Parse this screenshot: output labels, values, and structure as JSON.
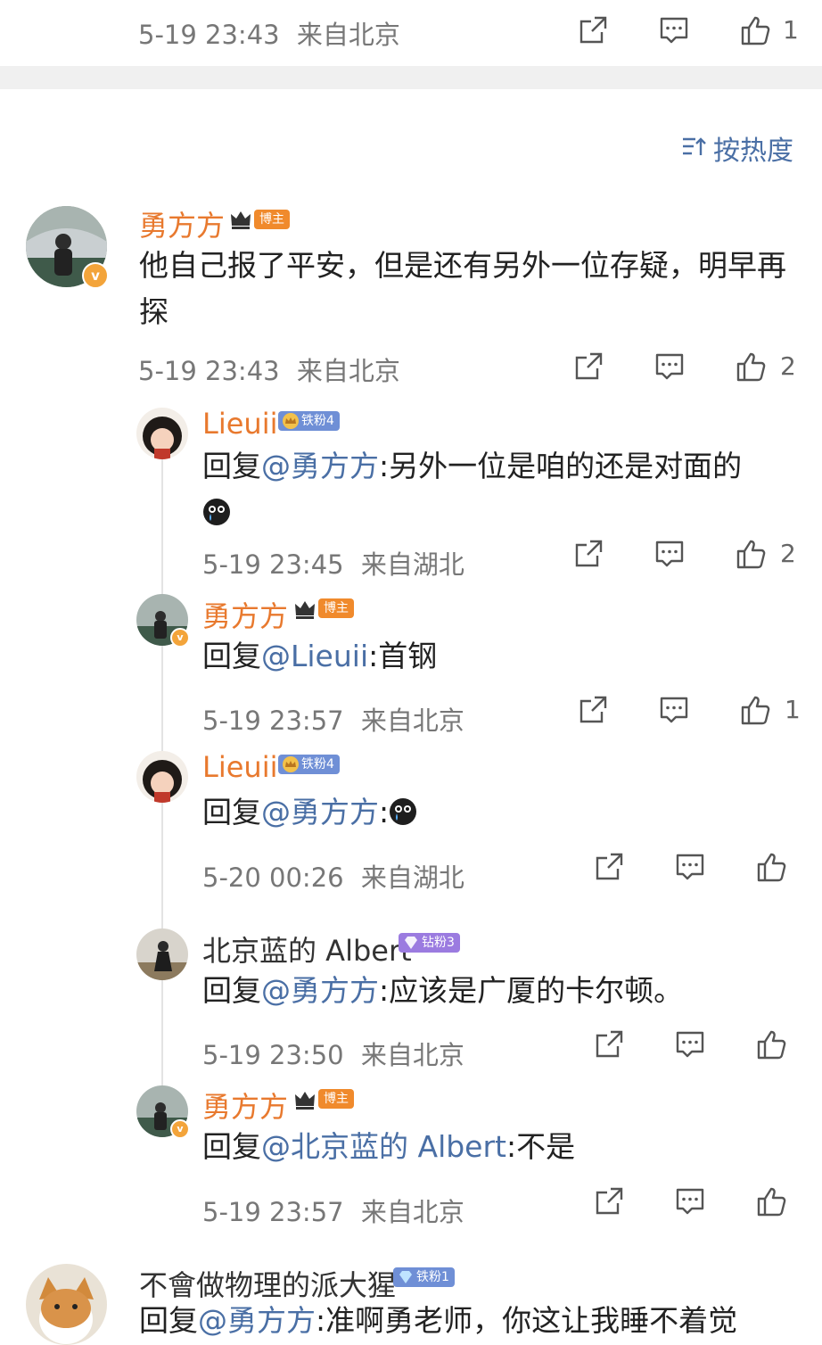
{
  "top_bar": {
    "time": "5-19 23:43",
    "location": "来自北京",
    "like_count": "1"
  },
  "sort": {
    "label": "按热度",
    "icon": "sort-icon"
  },
  "main_comment": {
    "user": "勇方方",
    "badge": "博主",
    "text": "他自己报了平安，但是还有另外一位存疑，明早再探",
    "time": "5-19 23:43",
    "location": "来自北京",
    "like_count": "2"
  },
  "replies": [
    {
      "user": "Lieuii",
      "badge": "铁粉4",
      "prefix": "回复",
      "mention": "@勇方方",
      "text": ":另外一位是咱的还是对面的",
      "emoji": "crying-emoji",
      "time": "5-19 23:45",
      "location": "来自湖北",
      "like_count": "2"
    },
    {
      "user": "勇方方",
      "badge": "博主",
      "prefix": "回复",
      "mention": "@Lieuii",
      "text": ":首钢",
      "time": "5-19 23:57",
      "location": "来自北京",
      "like_count": "1"
    },
    {
      "user": "Lieuii",
      "badge": "铁粉4",
      "prefix": "回复",
      "mention": "@勇方方",
      "text": ":",
      "emoji": "crying-emoji",
      "time": "5-20 00:26",
      "location": "来自湖北",
      "like_count": ""
    },
    {
      "user": "北京蓝的 Albert",
      "badge": "钻粉3",
      "prefix": "回复",
      "mention": "@勇方方",
      "text": ":应该是广厦的卡尔顿。",
      "time": "5-19 23:50",
      "location": "来自北京",
      "like_count": ""
    },
    {
      "user": "勇方方",
      "badge": "博主",
      "prefix": "回复",
      "mention": "@北京蓝的 Albert",
      "text": ":不是",
      "time": "5-19 23:57",
      "location": "来自北京",
      "like_count": ""
    }
  ],
  "next_comment": {
    "user": "不會做物理的派大猩",
    "badge": "铁粉1",
    "prefix": "回复",
    "mention": "@勇方方",
    "text": ":准啊勇老师，你这让我睡不着觉"
  },
  "colors": {
    "author": "#e8792e",
    "mention": "#4a6fa5",
    "blogger_badge": "#f08a2c",
    "fan_badge": "#6f8fd6",
    "diamond_badge": "#9b7be0"
  }
}
